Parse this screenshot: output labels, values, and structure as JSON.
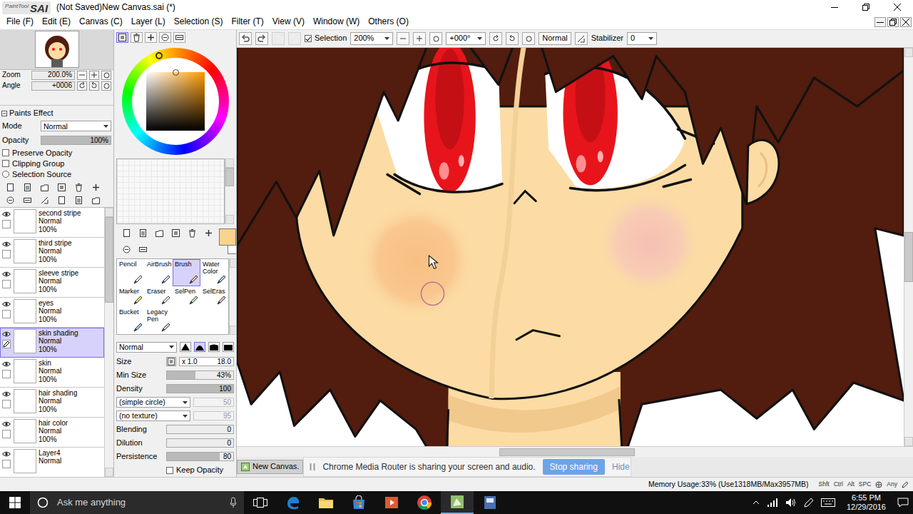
{
  "window": {
    "app_name": "PaintTool",
    "app_suffix": "SAI",
    "title": "(Not Saved)New Canvas.sai (*)"
  },
  "menu": [
    {
      "label": "File (F)"
    },
    {
      "label": "Edit (E)"
    },
    {
      "label": "Canvas (C)"
    },
    {
      "label": "Layer (L)"
    },
    {
      "label": "Selection (S)"
    },
    {
      "label": "Filter (T)"
    },
    {
      "label": "View (V)"
    },
    {
      "label": "Window (W)"
    },
    {
      "label": "Others (O)"
    }
  ],
  "navigator": {
    "zoom_label": "Zoom",
    "zoom": "200.0%",
    "angle_label": "Angle",
    "angle": "+0006"
  },
  "paints_effect": {
    "title": "Paints Effect",
    "mode_label": "Mode",
    "mode": "Normal",
    "opacity_label": "Opacity",
    "opacity": "100%",
    "opacity_level": 1,
    "options": [
      {
        "label": "Preserve Opacity",
        "kind": "checkbox",
        "checked": false
      },
      {
        "label": "Clipping Group",
        "kind": "checkbox",
        "checked": false
      },
      {
        "label": "Selection Source",
        "kind": "radio",
        "checked": false
      }
    ]
  },
  "layers": [
    {
      "name": "second stripe",
      "mode": "Normal",
      "opacity": "100%",
      "visible": true,
      "selected": false
    },
    {
      "name": "third stripe",
      "mode": "Normal",
      "opacity": "100%",
      "visible": true,
      "selected": false
    },
    {
      "name": "sleeve stripe",
      "mode": "Normal",
      "opacity": "100%",
      "visible": true,
      "selected": false
    },
    {
      "name": "eyes",
      "mode": "Normal",
      "opacity": "100%",
      "visible": true,
      "selected": false
    },
    {
      "name": "skin shading",
      "mode": "Normal",
      "opacity": "100%",
      "visible": true,
      "selected": true
    },
    {
      "name": "skin",
      "mode": "Normal",
      "opacity": "100%",
      "visible": true,
      "selected": false
    },
    {
      "name": "hair shading",
      "mode": "Normal",
      "opacity": "100%",
      "visible": true,
      "selected": false
    },
    {
      "name": "hair color",
      "mode": "Normal",
      "opacity": "100%",
      "visible": true,
      "selected": false
    },
    {
      "name": "Layer4",
      "mode": "Normal",
      "visible": true,
      "selected": false
    }
  ],
  "colors": {
    "foreground": "#fcd38c",
    "background": "#ffffff"
  },
  "tools": [
    {
      "label": "Pencil",
      "selected": false
    },
    {
      "label": "AirBrush",
      "selected": false
    },
    {
      "label": "Brush",
      "selected": true
    },
    {
      "label": "Water Color",
      "selected": false
    },
    {
      "label": "Marker",
      "selected": false
    },
    {
      "label": "Eraser",
      "selected": false
    },
    {
      "label": "SelPen",
      "selected": false
    },
    {
      "label": "SelEras",
      "selected": false
    },
    {
      "label": "Bucket",
      "selected": false
    },
    {
      "label": "Legacy Pen",
      "selected": false
    }
  ],
  "brush": {
    "mode": "Normal",
    "tips": [
      {
        "selected": false
      },
      {
        "selected": true
      },
      {
        "selected": false
      },
      {
        "selected": false
      }
    ],
    "size_label": "Size",
    "size_scale": "x 1.0",
    "size": "18.0",
    "min_size_label": "Min Size",
    "min_size": "43%",
    "min_size_level": 0.43,
    "density_label": "Density",
    "density": "100",
    "density_level": 1,
    "shape": {
      "label": "(simple circle)",
      "strength": "50",
      "disabled": true
    },
    "texture": {
      "label": "(no texture)",
      "strength": "95",
      "disabled": true
    },
    "blending_label": "Blending",
    "blending": "0",
    "blending_level": 0,
    "dilution_label": "Dilution",
    "dilution": "0",
    "dilution_level": 0,
    "persistence_label": "Persistence",
    "persistence": "80",
    "persistence_level": 0.8,
    "keep_opacity": {
      "label": "Keep Opacity",
      "checked": false
    }
  },
  "toolbar": {
    "selection": {
      "label": "Selection",
      "checked": true
    },
    "zoom": "200%",
    "angle": "+000°",
    "blend": "Normal",
    "stabilizer_label": "Stabilizer",
    "stabilizer": "0"
  },
  "canvas_tabs": [
    {
      "label": "New Canvas.",
      "selected": true
    }
  ],
  "share_bar": {
    "message": "Chrome Media Router is sharing your screen and audio.",
    "stop": "Stop sharing",
    "hide": "Hide"
  },
  "status_bar": {
    "memory": "Memory Usage:33% (Use1318MB/Max3957MB)",
    "keys": [
      {
        "label": "Shft"
      },
      {
        "label": "Ctrl"
      },
      {
        "label": "Alt"
      },
      {
        "label": "SPC"
      },
      {
        "label": "Any"
      }
    ]
  },
  "taskbar": {
    "search": "Ask me anything",
    "time": "6:55 PM",
    "date": "12/29/2016"
  }
}
